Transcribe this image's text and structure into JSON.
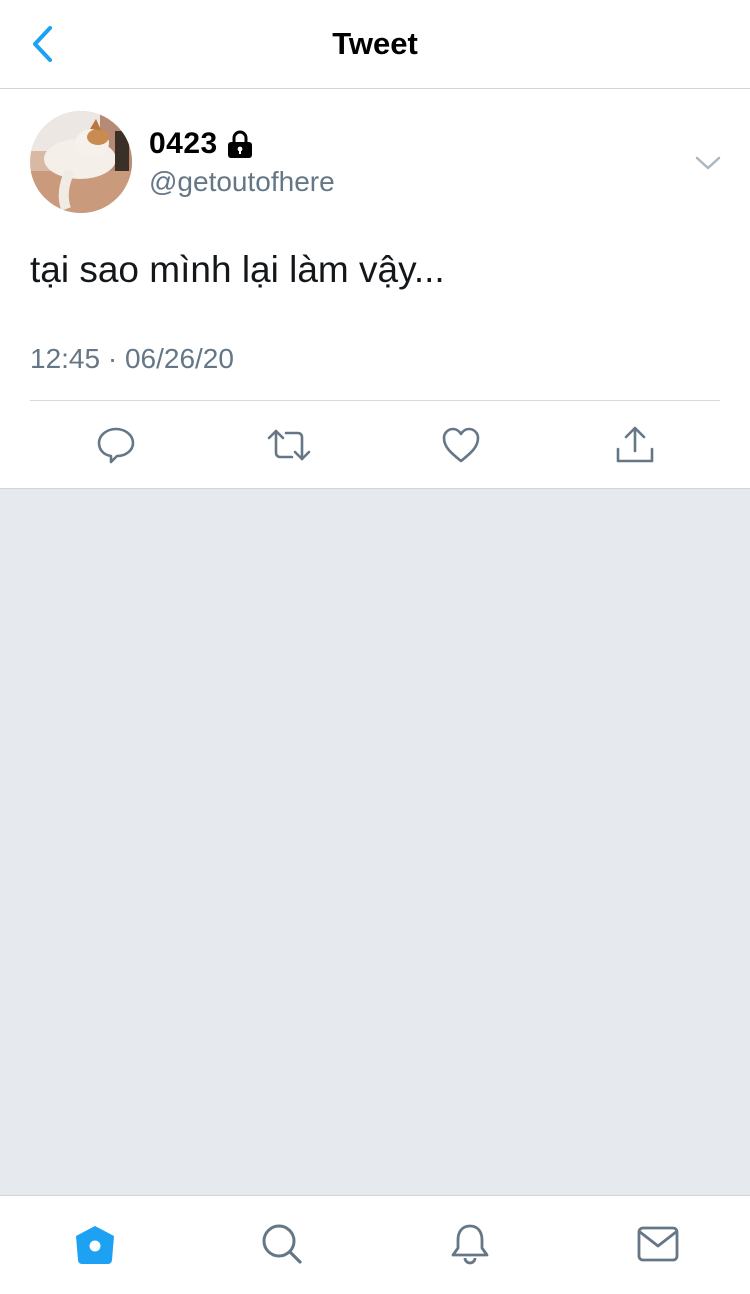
{
  "header": {
    "title": "Tweet",
    "back_icon": "chevron-left-icon"
  },
  "tweet": {
    "display_name": "0423",
    "protected_icon": "lock-icon",
    "handle": "@getoutofhere",
    "text": "tại sao mình lại làm vậy...",
    "timestamp": "12:45 · 06/26/20",
    "actions": [
      "reply-icon",
      "retweet-icon",
      "like-icon",
      "share-icon"
    ]
  },
  "bottom_nav": {
    "items": [
      "home-icon",
      "search-icon",
      "notifications-icon",
      "messages-icon"
    ],
    "active": "home-icon"
  },
  "colors": {
    "accent": "#1da1f2",
    "secondary_text": "#657786",
    "background": "#e6e9ed"
  }
}
